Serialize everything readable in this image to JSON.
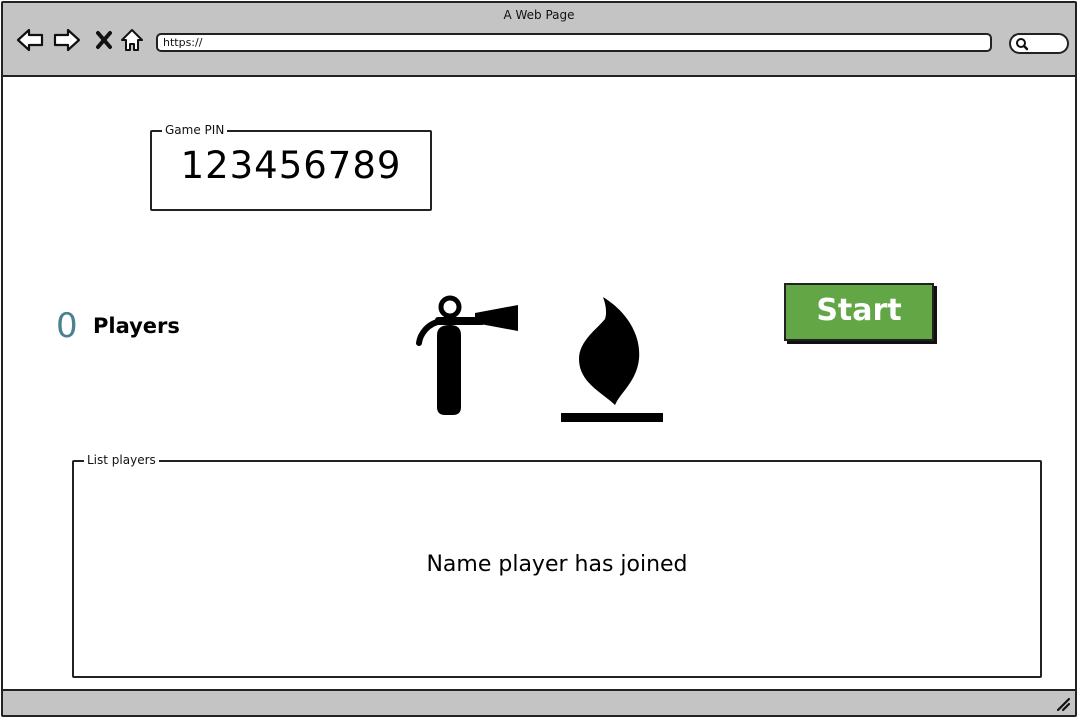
{
  "window": {
    "title": "A Web Page"
  },
  "browser": {
    "url": "https://"
  },
  "game_pin": {
    "legend": "Game PIN",
    "value": "123456789"
  },
  "players": {
    "count": "0",
    "label": "Players"
  },
  "start_button": {
    "label": "Start"
  },
  "list_players": {
    "legend": "List players",
    "message": "Name player has joined"
  },
  "icons": {
    "back": "arrow-left-icon",
    "forward": "arrow-right-icon",
    "stop": "close-icon",
    "home": "home-icon",
    "search": "search-icon",
    "extinguisher": "fire-extinguisher-icon",
    "flame": "flame-icon",
    "resize": "resize-grip-icon"
  },
  "colors": {
    "chrome": "#c4c4c4",
    "start_button": "#62a646",
    "player_count": "#4a8190"
  }
}
